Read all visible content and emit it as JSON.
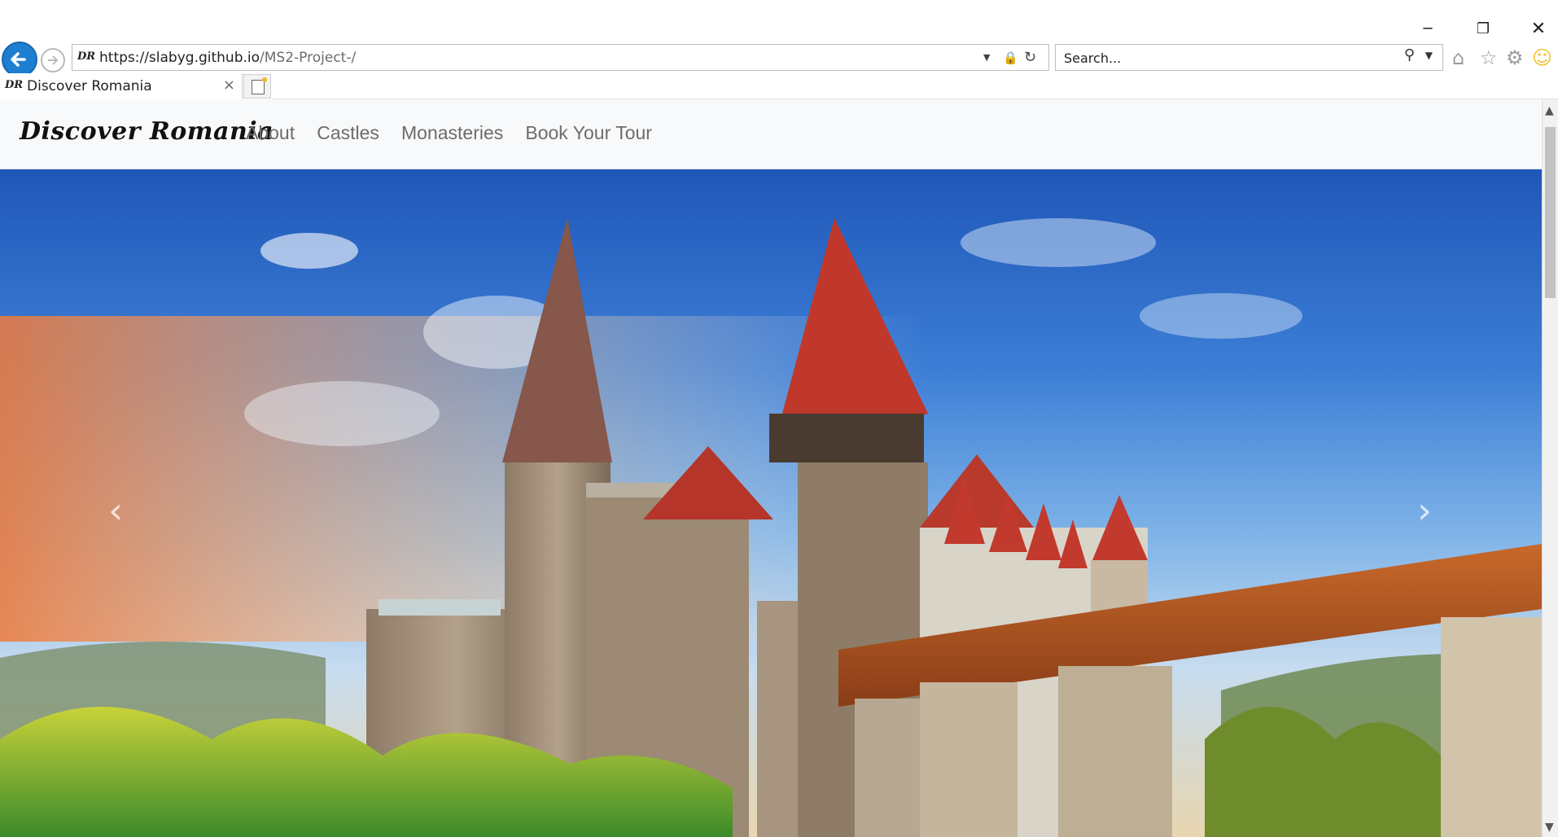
{
  "window": {
    "minimize_glyph": "─",
    "maximize_glyph": "❐",
    "close_glyph": "✕"
  },
  "addressbar": {
    "favicon_text": "DR",
    "url_host": "https://slabyg.github.io",
    "url_path": "/MS2-Project-/",
    "icons": [
      "dropdown-caret-icon",
      "lock-icon",
      "refresh-icon"
    ]
  },
  "search": {
    "placeholder": "Search...",
    "icons": [
      "magnifier-icon",
      "dropdown-caret-icon"
    ]
  },
  "toolbar_icons": [
    "home-icon",
    "favorites-star-icon",
    "settings-gear-icon",
    "feedback-smiley-icon"
  ],
  "tab": {
    "favicon_text": "DR",
    "title": "Discover Romania",
    "close_glyph": "×"
  },
  "site": {
    "brand": "Discover Romania",
    "nav": [
      {
        "label": "About"
      },
      {
        "label": "Castles"
      },
      {
        "label": "Monasteries"
      },
      {
        "label": "Book Your Tour"
      }
    ]
  },
  "carousel": {
    "prev_glyph": "‹",
    "next_glyph": "›",
    "image_subject": "castle-photo"
  }
}
